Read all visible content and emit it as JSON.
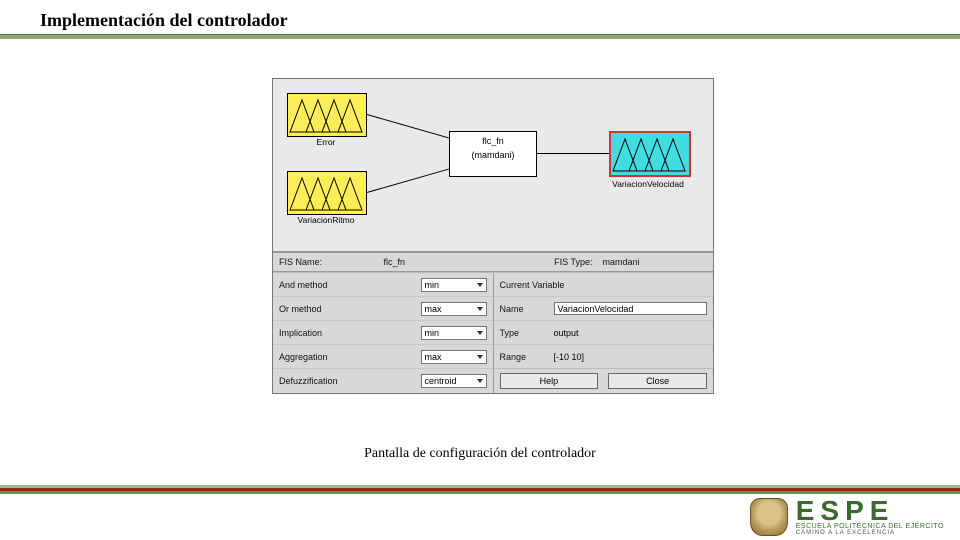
{
  "slide": {
    "title": "Implementación del controlador",
    "caption": "Pantalla de configuración del controlador"
  },
  "fis": {
    "inputs": [
      {
        "label": "Error"
      },
      {
        "label": "VariacionRitmo"
      }
    ],
    "center": {
      "name": "flc_fn",
      "type_display": "(mamdani)"
    },
    "output": {
      "label": "VariacionVelocidad"
    },
    "info": {
      "name_label": "FIS Name:",
      "name_value": "flc_fn",
      "type_label": "FIS Type:",
      "type_value": "mamdani"
    }
  },
  "methods": {
    "and": {
      "label": "And method",
      "value": "min"
    },
    "or": {
      "label": "Or method",
      "value": "max"
    },
    "impl": {
      "label": "Implication",
      "value": "min"
    },
    "agg": {
      "label": "Aggregation",
      "value": "max"
    },
    "defuzz": {
      "label": "Defuzzification",
      "value": "centroid"
    }
  },
  "currentVar": {
    "header": "Current Variable",
    "name_label": "Name",
    "name_value": "VariacionVelocidad",
    "type_label": "Type",
    "type_value": "output",
    "range_label": "Range",
    "range_value": "[-10 10]"
  },
  "buttons": {
    "help": "Help",
    "close": "Close"
  },
  "footer": {
    "org": "ESPE",
    "line1": "ESCUELA POLITÉCNICA DEL EJÉRCITO",
    "line2": "CAMINO A LA EXCELENCIA"
  }
}
